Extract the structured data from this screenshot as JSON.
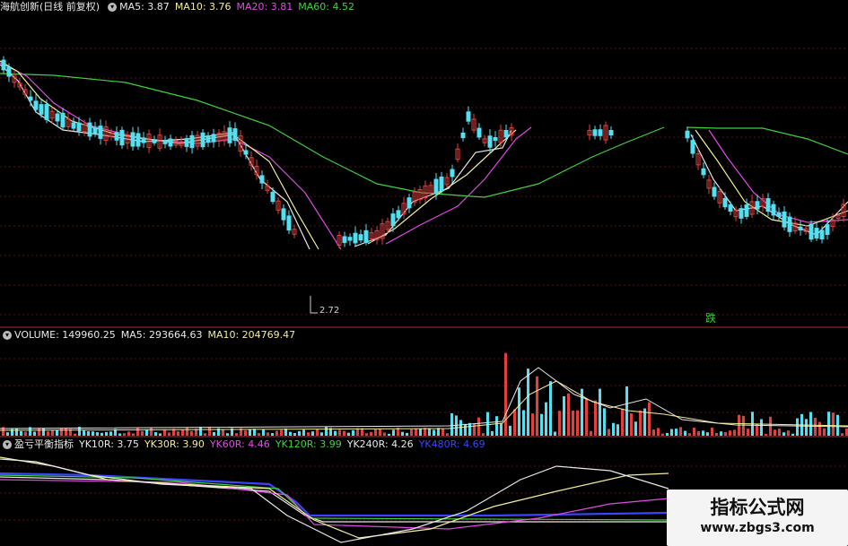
{
  "price_panel": {
    "stock_name": "海航创新(日线 前复权)",
    "ma_legend": [
      {
        "label": "MA5: 3.87",
        "color": "#e8e8e8"
      },
      {
        "label": "MA10: 3.76",
        "color": "#f2ee9a"
      },
      {
        "label": "MA20: 3.81",
        "color": "#e14ae6"
      },
      {
        "label": "MA60: 4.52",
        "color": "#3fd13f"
      }
    ],
    "low_price_label": "2.72",
    "fall_marker": "跌"
  },
  "volume_panel": {
    "legend": [
      {
        "label": "VOLUME: 149960.25",
        "color": "#e8e8e8"
      },
      {
        "label": "MA5: 293664.63",
        "color": "#e8e8e8"
      },
      {
        "label": "MA10: 204769.47",
        "color": "#f2ee9a"
      }
    ]
  },
  "indicator_panel": {
    "indicator_name": "盈亏平衡指标",
    "legend": [
      {
        "label": "YK10R: 3.75",
        "color": "#e8e8e8"
      },
      {
        "label": "YK30R: 3.90",
        "color": "#f2ee9a"
      },
      {
        "label": "YK60R: 4.46",
        "color": "#e14ae6"
      },
      {
        "label": "YK120R: 3.99",
        "color": "#3fd13f"
      },
      {
        "label": "YK240R: 4.26",
        "color": "#e8e8e8"
      },
      {
        "label": "YK480R: 4.69",
        "color": "#3a45ff"
      }
    ]
  },
  "watermark": {
    "title": "指标公式网",
    "url": "www.zbgs3.com"
  },
  "colors": {
    "background": "#000000",
    "up": "#e04040",
    "down": "#54e0f0",
    "grid": "#5a0f0f",
    "separator": "#b03030"
  }
}
